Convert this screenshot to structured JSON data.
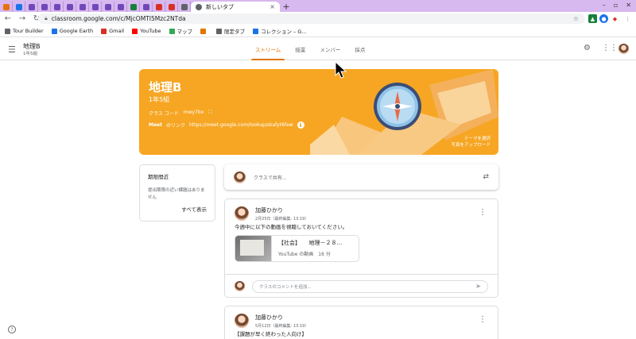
{
  "browser": {
    "tabs": [
      {
        "color": "#e8710a"
      },
      {
        "color": "#1a73e8"
      },
      {
        "color": "#7248b9"
      },
      {
        "color": "#7248b9"
      },
      {
        "color": "#7248b9"
      },
      {
        "color": "#7248b9"
      },
      {
        "color": "#7248b9"
      },
      {
        "color": "#7248b9"
      },
      {
        "color": "#7248b9"
      },
      {
        "color": "#7248b9"
      },
      {
        "color": "#188038"
      },
      {
        "color": "#7248b9"
      },
      {
        "color": "#d93025"
      },
      {
        "color": "#d93025"
      },
      {
        "color": "#5f6368"
      }
    ],
    "active_tab_title": "新しいタブ",
    "active_tab_close": "×",
    "new_tab": "+",
    "url": "classroom.google.com/c/MjcOMTI5Mzc2NTda",
    "bookmarks": [
      {
        "label": "Tour Builder",
        "color": "#5f6368"
      },
      {
        "label": "Google Earth",
        "color": "#1a73e8"
      },
      {
        "label": "Gmail",
        "color": "#d93025"
      },
      {
        "label": "YouTube",
        "color": "#ff0000"
      },
      {
        "label": "マップ",
        "color": "#34a853"
      },
      {
        "label": "",
        "color": "#e37400"
      },
      {
        "label": "限定タブ",
        "color": "#5f6368"
      },
      {
        "label": "コレクション – G...",
        "color": "#1a73e8"
      }
    ]
  },
  "appbar": {
    "class_name": "地理B",
    "section": "1年5組",
    "tabs": [
      {
        "label": "ストリーム",
        "active": true
      },
      {
        "label": "授業",
        "active": false
      },
      {
        "label": "メンバー",
        "active": false
      },
      {
        "label": "採点",
        "active": false
      }
    ]
  },
  "banner": {
    "title": "地理B",
    "section": "1年5組",
    "class_code_label": "クラス コード",
    "class_code": "mwy7bx",
    "meet_label": "Meet",
    "meet_link_label": "のリンク",
    "meet_url": "https://meet.google.com/lookup/skafyt6few",
    "theme_select": "テーマを選択",
    "upload_photo": "写真をアップロード",
    "bg_color": "#f6a623"
  },
  "upcoming": {
    "heading": "期限間近",
    "text": "提出期限の近い課題はありません",
    "view_all": "すべて表示"
  },
  "share": {
    "placeholder": "クラスで共有..."
  },
  "posts": [
    {
      "author": "加藤ひかり",
      "date": "2月25日（最終編集: 13:19）",
      "body": "今週中に以下の動画を視聴しておいてください。",
      "attachment_title": "【社会】　　地理－２８...",
      "attachment_sub": "YouTube の動画　16 分",
      "comment_placeholder": "クラスのコメントを追加..."
    },
    {
      "author": "加藤ひかり",
      "date": "5月12日（最終編集: 13:19）",
      "body": "【課題が早く終わった人向け】"
    }
  ]
}
